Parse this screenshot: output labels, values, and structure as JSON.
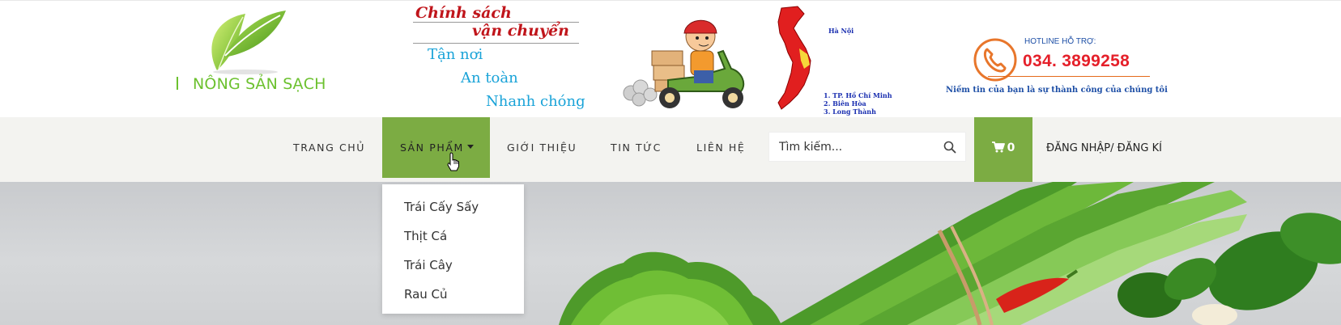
{
  "banner": {
    "logo_text": "NÔNG SẢN SẠCH",
    "shipping": {
      "title_line1": "Chính sách",
      "title_line2": "vận chuyển",
      "line1": "Tận nơi",
      "line2": "An toàn",
      "line3": "Nhanh chóng"
    },
    "map": {
      "capital": "Hà Nội",
      "locations": [
        "1. TP. Hồ Chí Minh",
        "2. Biên Hòa",
        "3. Long Thành"
      ]
    },
    "hotline": {
      "label": "HOTLINE HỖ TRỢ:",
      "number": "034. 3899258",
      "slogan": "Niềm tin của bạn là sự thành công của chúng tôi"
    }
  },
  "nav": {
    "home": "TRANG CHỦ",
    "products": "SẢN PHẨM",
    "about": "GIỚI THIỆU",
    "news": "TIN TỨC",
    "contact": "LIÊN HỆ",
    "search_placeholder": "Tìm kiếm...",
    "cart_count": "0",
    "login": "ĐĂNG NHẬP",
    "separator": "/",
    "register": "ĐĂNG KÍ"
  },
  "dropdown": {
    "items": [
      "Trái Cấy Sấy",
      "Thịt Cá",
      "Trái Cây",
      "Rau Củ"
    ]
  },
  "colors": {
    "accent_green": "#7cac43",
    "logo_green": "#6cc12f",
    "hotline_red": "#e5202a"
  },
  "icons": {
    "search": "search-icon",
    "cart": "cart-icon",
    "phone": "phone-icon",
    "caret": "caret-down-icon"
  }
}
